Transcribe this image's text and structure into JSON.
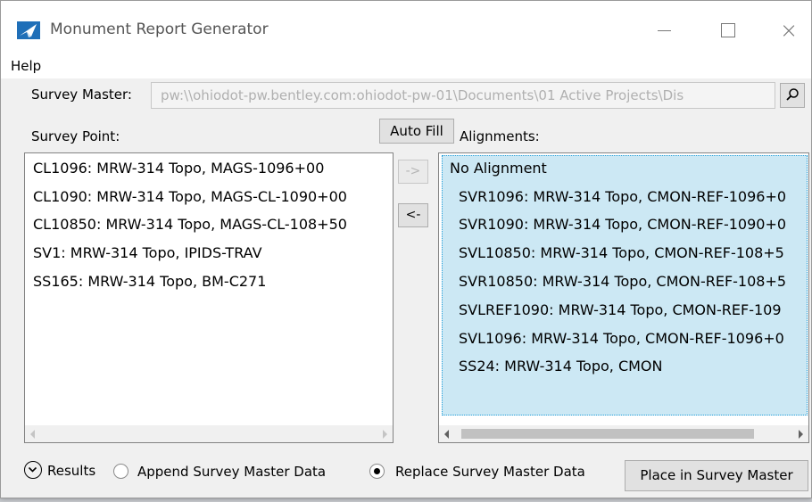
{
  "window": {
    "title": "Monument Report Generator",
    "close_glyph": "×"
  },
  "menu": {
    "help": "Help"
  },
  "survey_master": {
    "label": "Survey Master:",
    "value": "pw:\\\\ohiodot-pw.bentley.com:ohiodot-pw-01\\Documents\\01 Active Projects\\Dis"
  },
  "survey_point": {
    "label": "Survey Point:",
    "items": [
      "CL1096: MRW-314 Topo, MAGS-1096+00",
      "CL1090: MRW-314 Topo, MAGS-CL-1090+00",
      "CL10850: MRW-314 Topo, MAGS-CL-108+50",
      "SV1: MRW-314 Topo, IPIDS-TRAV",
      "SS165: MRW-314 Topo, BM-C271"
    ]
  },
  "auto_fill_label": "Auto Fill",
  "move_right_label": "->",
  "move_left_label": "<-",
  "alignments": {
    "label": "Alignments:",
    "header_item": "No Alignment",
    "items": [
      "SVR1096: MRW-314 Topo, CMON-REF-1096+0",
      "SVR1090: MRW-314 Topo, CMON-REF-1090+0",
      "SVL10850: MRW-314 Topo, CMON-REF-108+5",
      "SVR10850: MRW-314 Topo, CMON-REF-108+5",
      "SVLREF1090: MRW-314 Topo, CMON-REF-109",
      "SVL1096: MRW-314 Topo, CMON-REF-1096+0",
      "SS24: MRW-314 Topo, CMON"
    ]
  },
  "footer": {
    "results_label": "Results",
    "append_label": "Append Survey Master Data",
    "replace_label": "Replace Survey Master Data",
    "selected_option": "Replace Survey Master Data",
    "place_button_label": "Place in Survey Master"
  },
  "icons": {
    "app": "monument-app-icon",
    "search": "search-icon",
    "expander": "chevron-down-circle-icon"
  },
  "colors": {
    "selection": "#cce8f4",
    "selection_border": "#26a0da",
    "app_icon_blue": "#1f6fb8"
  }
}
